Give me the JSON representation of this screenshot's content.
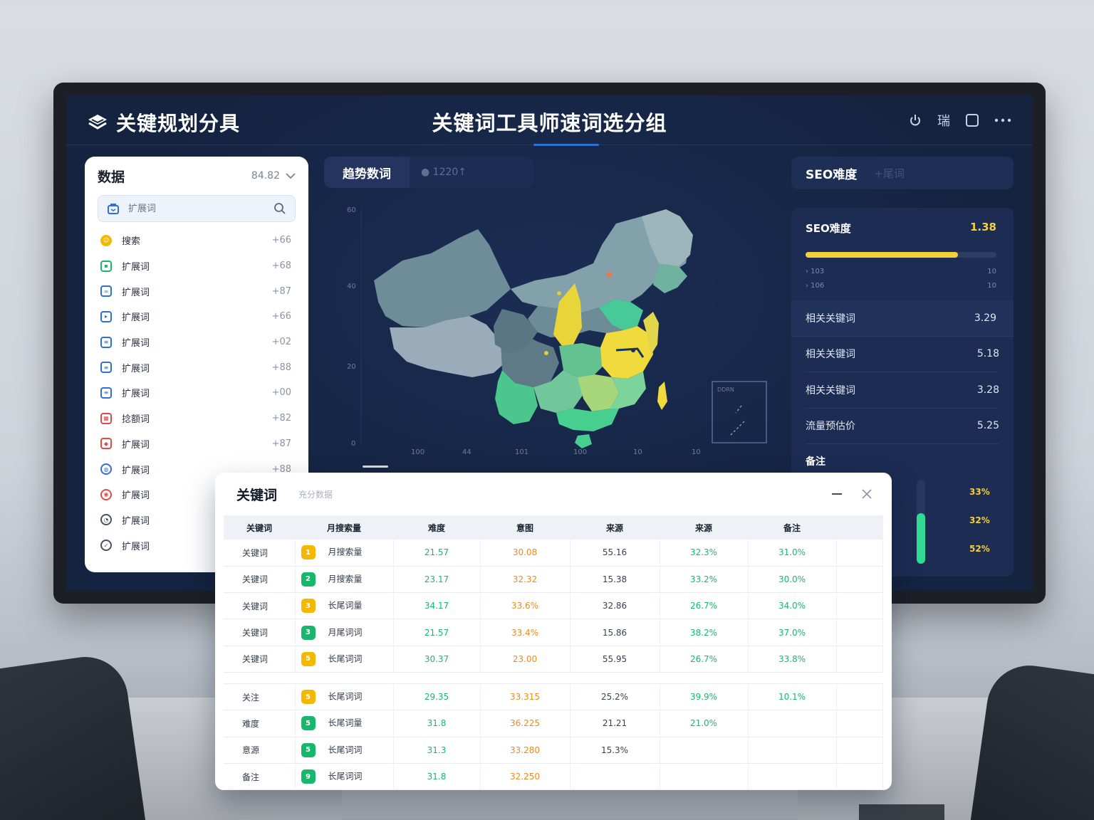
{
  "header": {
    "logo_text": "关键规划分具",
    "title": "关键词工具师速词选分组",
    "icon_label": "瑞"
  },
  "left_panel": {
    "title": "数据",
    "meta": "84.82",
    "search_placeholder": "扩展词",
    "items": [
      {
        "label": "搜索",
        "value": "+66",
        "icon": "smile-icon",
        "color": "#f5b800"
      },
      {
        "label": "扩展词",
        "value": "+68",
        "icon": "chart-icon",
        "color": "#18b86c"
      },
      {
        "label": "扩展词",
        "value": "+87",
        "icon": "link-icon",
        "color": "#2e6fd8"
      },
      {
        "label": "扩展词",
        "value": "+66",
        "icon": "play-icon",
        "color": "#2e6fd8"
      },
      {
        "label": "扩展词",
        "value": "+02",
        "icon": "doc-icon",
        "color": "#2e6fd8"
      },
      {
        "label": "扩展词",
        "value": "+88",
        "icon": "doc-icon",
        "color": "#2e6fd8"
      },
      {
        "label": "扩展词",
        "value": "+00",
        "icon": "doc-icon",
        "color": "#2e6fd8"
      },
      {
        "label": "捻额词",
        "value": "+82",
        "icon": "grid-icon",
        "color": "#e54848"
      },
      {
        "label": "扩展词",
        "value": "+87",
        "icon": "tag-icon",
        "color": "#e54848"
      },
      {
        "label": "扩展词",
        "value": "+88",
        "icon": "globe-icon",
        "color": "#2e6fd8"
      },
      {
        "label": "扩展词",
        "value": "",
        "icon": "target-icon",
        "color": "#e54848"
      },
      {
        "label": "扩展词",
        "value": "",
        "icon": "clock-icon",
        "color": "#4a5262"
      },
      {
        "label": "扩展词",
        "value": "",
        "icon": "check-icon",
        "color": "#4a5262"
      }
    ]
  },
  "center": {
    "tab_label": "趋势数词",
    "tab_meta": "1220↑",
    "y_ticks": [
      "60",
      "40",
      "20",
      "0"
    ],
    "x_ticks": [
      "100",
      "44",
      "101",
      "100",
      "10",
      "10"
    ],
    "inset_label": "DDRN"
  },
  "seo": {
    "tab_title": "SEO难度",
    "tab_sub": "+尾词",
    "card_title": "SEO难度",
    "score": "1.38",
    "progress": 0.8,
    "legend": [
      {
        "left": "› 103",
        "right": "10"
      },
      {
        "left": "› 106",
        "right": "10"
      }
    ],
    "rows": [
      {
        "label": "相关关键词",
        "value": "3.29"
      },
      {
        "label": "相关关键词",
        "value": "5.18"
      },
      {
        "label": "相关关键词",
        "value": "3.28"
      },
      {
        "label": "流量预估价",
        "value": "5.25"
      }
    ],
    "sub_title": "备注",
    "vbar_level": 0.6,
    "pcts": [
      "33%",
      "32%",
      "52%"
    ]
  },
  "table_window": {
    "title": "关键词",
    "subtitle": "充分数据",
    "columns": [
      "关键词",
      "月搜索量",
      "难度",
      "意图",
      "来源",
      "来源",
      "备注"
    ],
    "rows": [
      {
        "kw": "关键词",
        "n": "1",
        "nc": "#f5b800",
        "t": "月搜索量",
        "a": "21.57",
        "b": "30.08",
        "c": "55.16",
        "d": "32.3%",
        "e": "31.0%"
      },
      {
        "kw": "关键词",
        "n": "2",
        "nc": "#18b86c",
        "t": "月搜索量",
        "a": "23.17",
        "b": "32.32",
        "c": "15.38",
        "d": "33.2%",
        "e": "30.0%"
      },
      {
        "kw": "关键词",
        "n": "3",
        "nc": "#f5b800",
        "t": "长尾词量",
        "a": "34.17",
        "b": "33.6%",
        "c": "32.86",
        "d": "26.7%",
        "e": "34.0%"
      },
      {
        "kw": "关键词",
        "n": "3",
        "nc": "#18b86c",
        "t": "月尾词词",
        "a": "21.57",
        "b": "33.4%",
        "c": "15.86",
        "d": "38.2%",
        "e": "37.0%"
      },
      {
        "kw": "关键词",
        "n": "5",
        "nc": "#f5b800",
        "t": "长尾词词",
        "a": "30.37",
        "b": "23.00",
        "c": "55.95",
        "d": "26.7%",
        "e": "33.8%"
      },
      {
        "kw": "关注",
        "n": "5",
        "nc": "#f5b800",
        "t": "长尾词词",
        "a": "29.35",
        "b": "33.315",
        "c": "25.2%",
        "d": "39.9%",
        "e": "10.1%"
      },
      {
        "kw": "难度",
        "n": "5",
        "nc": "#18b86c",
        "t": "长尾词量",
        "a": "31.8",
        "b": "36.225",
        "c": "21.21",
        "d": "21.0%",
        "e": ""
      },
      {
        "kw": "意源",
        "n": "5",
        "nc": "#18b86c",
        "t": "长尾词词",
        "a": "31.3",
        "b": "33.280",
        "c": "15.3%",
        "d": "",
        "e": ""
      },
      {
        "kw": "备注",
        "n": "9",
        "nc": "#18b86c",
        "t": "长尾词词",
        "a": "31.8",
        "b": "32.250",
        "c": "",
        "d": "",
        "e": ""
      }
    ]
  },
  "colors": {
    "accent": "#2e6fd8",
    "yellow": "#f5cf3b",
    "green": "#18b86c",
    "orange": "#ee8a1c",
    "screen_bg": "#16264a"
  }
}
